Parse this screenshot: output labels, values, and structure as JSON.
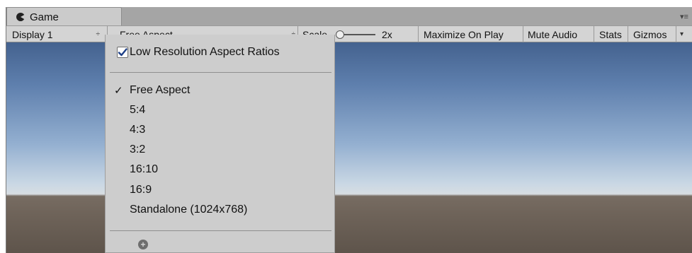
{
  "tab": {
    "title": "Game",
    "icon": "pacman-game-icon"
  },
  "panel_menu": {
    "icon": "panel-menu-icon",
    "glyph": "▾≡"
  },
  "toolbar": {
    "display": {
      "value": "Display 1",
      "glyph": "÷"
    },
    "aspect": {
      "value": "Free Aspect",
      "glyph": "÷"
    },
    "scale": {
      "label": "Scale",
      "value": "2x",
      "level": 0.0
    },
    "maximize_label": "Maximize On Play",
    "mute_label": "Mute Audio",
    "stats_label": "Stats",
    "gizmos_label": "Gizmos",
    "gizmos_glyph": "▾"
  },
  "dropdown": {
    "low_res": {
      "label": "Low Resolution Aspect Ratios",
      "checked": true
    },
    "items": [
      {
        "label": "Free Aspect",
        "selected": true,
        "tick": "✓"
      },
      {
        "label": "5:4",
        "selected": false,
        "tick": ""
      },
      {
        "label": "4:3",
        "selected": false,
        "tick": ""
      },
      {
        "label": "3:2",
        "selected": false,
        "tick": ""
      },
      {
        "label": "16:10",
        "selected": false,
        "tick": ""
      },
      {
        "label": "16:9",
        "selected": false,
        "tick": ""
      },
      {
        "label": "Standalone (1024x768)",
        "selected": false,
        "tick": ""
      }
    ],
    "add_icon": "plus-circle-icon",
    "add_glyph": "+"
  },
  "colors": {
    "sky_top": "#44628f",
    "horizon": "#d7dde2",
    "ground": "#6e6359",
    "panel": "#cdcdcd",
    "toolbar": "#d4d4d4"
  }
}
